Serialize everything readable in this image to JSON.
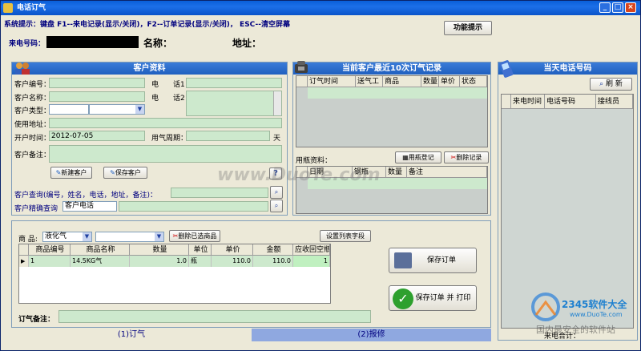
{
  "window": {
    "title": "电话订气"
  },
  "system_hint": "系统提示：键盘 F1--来电记录(显示/关闭)，F2--订单记录(显示/关闭)， ESC--清空屏幕",
  "func_hint_button": "功能提示",
  "caller": {
    "number_label": "来电号码：",
    "name_label": "名称：",
    "address_label": "地址："
  },
  "customer": {
    "title": "客户资料",
    "id_label": "客户编号：",
    "name_label": "客户名称：",
    "type_label": "客户类型：",
    "addr_label": "使用地址：",
    "open_label": "开户时间：",
    "open_value": "2012-07-05",
    "cycle_label": "用气周期：",
    "cycle_unit": "天",
    "note_label": "客户备注：",
    "phone1_label": "电　　话1：",
    "phone2_label": "电　　话2：",
    "new_button": "新建客户",
    "save_button": "保存客户",
    "help_button": "?",
    "query_label": "客户查询(编号，姓名，电话，地址，备注)：",
    "exact_label": "客户精确查询",
    "exact_select": "客户电话"
  },
  "recent_orders": {
    "title": "当前客户最近10次订气记录",
    "columns": [
      "订气时间",
      "送气工",
      "商品",
      "数量",
      "单价",
      "状态"
    ],
    "bottle_label": "用瓶资料：",
    "register_button": "用瓶登记",
    "delete_button": "删除记录",
    "bottle_columns": [
      "日期",
      "钢瓶",
      "数量",
      "备注"
    ]
  },
  "today_calls": {
    "title": "当天电话号码",
    "refresh_button": "刷 新",
    "columns": [
      "来电时间",
      "电话号码",
      "接线员"
    ],
    "count_label": "来电合计："
  },
  "order": {
    "product_label": "商 品:",
    "product_select": "液化气",
    "delete_selected_button": "删除已选商品",
    "set_columns_button": "设置列表字段",
    "columns": [
      "商品编号",
      "商品名称",
      "数量",
      "单位",
      "单价",
      "金额",
      "应收回空瓶数"
    ],
    "rows": [
      {
        "code": "1",
        "name": "14.5KG气",
        "qty": "1.0",
        "unit": "瓶",
        "price": "110.0",
        "amount": "110.0",
        "bottles": "1"
      }
    ],
    "save_button": "保存订单",
    "save_print_button": "保存订单 并 打印",
    "note_label": "订气备注："
  },
  "tabs": [
    {
      "label": "(1)订气"
    },
    {
      "label": "(2)报修"
    }
  ],
  "watermarks": {
    "left": "www.DuoTe.com",
    "right_brand": "2345软件大全",
    "right_url": "www.DuoTe.com",
    "right_sub": "国内最安全的软件站"
  },
  "colors": {
    "title_blue": "#1f5fbf",
    "field_green": "#cde9cd",
    "tab_active": "#8fa8e0"
  }
}
